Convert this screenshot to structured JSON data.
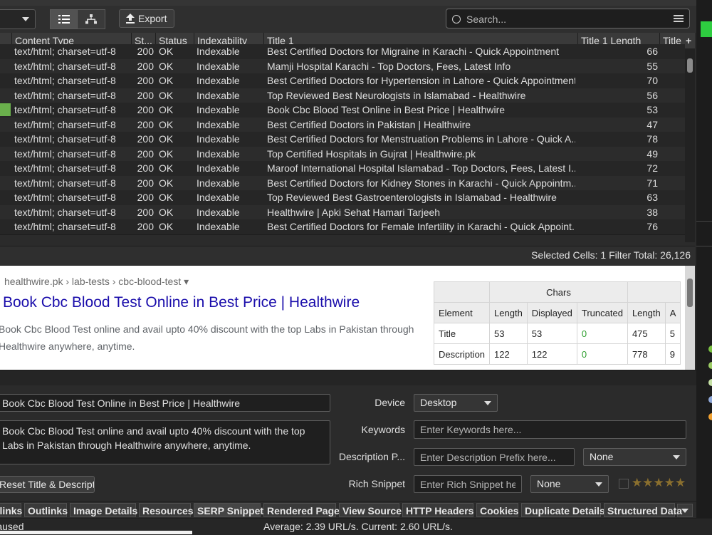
{
  "toolbar": {
    "export_label": "Export",
    "search_placeholder": "Search..."
  },
  "columns": [
    "Content Type",
    "St...",
    "Status",
    "Indexability",
    "Title 1",
    "Title 1 Length",
    "Title"
  ],
  "add_column_label": "+",
  "rows": [
    {
      "content_type": "text/html; charset=utf-8",
      "status_code": "200",
      "status": "OK",
      "indexability": "Indexable",
      "title": "Best Certified Doctors for Migraine in Karachi - Quick Appointment",
      "length": "66"
    },
    {
      "content_type": "text/html; charset=utf-8",
      "status_code": "200",
      "status": "OK",
      "indexability": "Indexable",
      "title": "Mamji Hospital Karachi - Top Doctors, Fees, Latest Info",
      "length": "55"
    },
    {
      "content_type": "text/html; charset=utf-8",
      "status_code": "200",
      "status": "OK",
      "indexability": "Indexable",
      "title": "Best Certified Doctors for Hypertension  in Lahore - Quick Appointment",
      "length": "70"
    },
    {
      "content_type": "text/html; charset=utf-8",
      "status_code": "200",
      "status": "OK",
      "indexability": "Indexable",
      "title": "Top Reviewed Best Neurologists in Islamabad - Healthwire",
      "length": "56"
    },
    {
      "content_type": "text/html; charset=utf-8",
      "status_code": "200",
      "status": "OK",
      "indexability": "Indexable",
      "title": "Book Cbc Blood Test Online in Best Price | Healthwire",
      "length": "53"
    },
    {
      "content_type": "text/html; charset=utf-8",
      "status_code": "200",
      "status": "OK",
      "indexability": "Indexable",
      "title": "Best Certified Doctors in Pakistan | Healthwire",
      "length": "47"
    },
    {
      "content_type": "text/html; charset=utf-8",
      "status_code": "200",
      "status": "OK",
      "indexability": "Indexable",
      "title": "Best Certified Doctors for Menstruation Problems in Lahore - Quick A...",
      "length": "78"
    },
    {
      "content_type": "text/html; charset=utf-8",
      "status_code": "200",
      "status": "OK",
      "indexability": "Indexable",
      "title": "Top Certified Hospitals in Gujrat | Healthwire.pk",
      "length": "49"
    },
    {
      "content_type": "text/html; charset=utf-8",
      "status_code": "200",
      "status": "OK",
      "indexability": "Indexable",
      "title": "Maroof International Hospital Islamabad - Top Doctors, Fees, Latest I...",
      "length": "72"
    },
    {
      "content_type": "text/html; charset=utf-8",
      "status_code": "200",
      "status": "OK",
      "indexability": "Indexable",
      "title": "Best Certified Doctors for Kidney Stones in Karachi - Quick Appointm...",
      "length": "71"
    },
    {
      "content_type": "text/html; charset=utf-8",
      "status_code": "200",
      "status": "OK",
      "indexability": "Indexable",
      "title": "Top Reviewed Best Gastroenterologists in Islamabad - Healthwire",
      "length": "63"
    },
    {
      "content_type": "text/html; charset=utf-8",
      "status_code": "200",
      "status": "OK",
      "indexability": "Indexable",
      "title": "Healthwire | Apki Sehat Hamari Tarjeeh",
      "length": "38"
    },
    {
      "content_type": "text/html; charset=utf-8",
      "status_code": "200",
      "status": "OK",
      "indexability": "Indexable",
      "title": "Best Certified Doctors for Female Infertility in Karachi - Quick Appoint...",
      "length": "76"
    }
  ],
  "status_bar": {
    "selected_label": "Selected Cells:",
    "selected_value": "1",
    "filter_label": "Filter Total:",
    "filter_value": "26,126"
  },
  "serp": {
    "breadcrumb": "healthwire.pk › lab-tests › cbc-blood-test ▾",
    "title": "Book Cbc Blood Test Online in Best Price | Healthwire",
    "description_line1": "Book Cbc Blood Test online and avail upto 40% discount with the top Labs in Pakistan through",
    "description_line2": "Healthwire anywhere, anytime."
  },
  "chars_table": {
    "group_header": "Chars",
    "headers": [
      "Element",
      "Length",
      "Displayed",
      "Truncated",
      "Length",
      "A"
    ],
    "rows": [
      {
        "element": "Title",
        "length": "53",
        "displayed": "53",
        "truncated": "0",
        "px_length": "475",
        "extra": "5"
      },
      {
        "element": "Description",
        "length": "122",
        "displayed": "122",
        "truncated": "0",
        "px_length": "778",
        "extra": "9"
      }
    ]
  },
  "editor": {
    "title_value": "Book Cbc Blood Test Online in Best Price | Healthwire",
    "description_value": "Book Cbc Blood Test online and avail upto 40% discount with the top Labs in Pakistan through Healthwire anywhere, anytime.",
    "reset_label": "Reset Title & Description",
    "device_label": "Device",
    "device_value": "Desktop",
    "keywords_label": "Keywords",
    "keywords_placeholder": "Enter Keywords here...",
    "desc_prefix_label": "Description P...",
    "desc_prefix_placeholder": "Enter Description Prefix here...",
    "desc_prefix_select": "None",
    "rich_snippet_label": "Rich Snippet",
    "rich_snippet_placeholder": "Enter Rich Snippet here",
    "rich_snippet_select": "None",
    "stars": "★★★★★"
  },
  "tabs": [
    "Inlinks",
    "Outlinks",
    "Image Details",
    "Resources",
    "SERP Snippet",
    "Rendered Page",
    "View Source",
    "HTTP Headers",
    "Cookies",
    "Duplicate Details",
    "Structured Data"
  ],
  "bottom": {
    "left_text": "Paused",
    "average_text": "Average: 2.39 URL/s. Current: 2.60 URL/s."
  },
  "colors": {
    "accent_green": "#2ecc40",
    "serp_title": "#1a0dab",
    "truncated_zero": "#2e9e2e"
  }
}
